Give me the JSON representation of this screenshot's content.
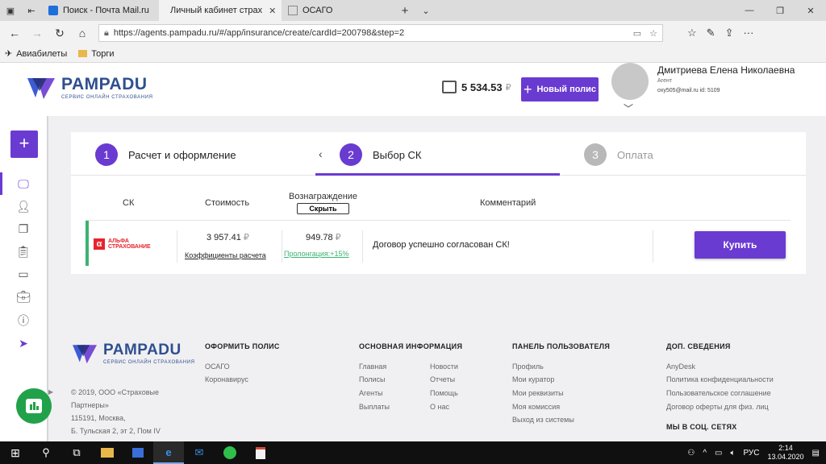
{
  "browser": {
    "tabs": [
      {
        "label": "Поиск - Почта Mail.ru",
        "active": false
      },
      {
        "label": "Личный кабинет страх",
        "active": true
      },
      {
        "label": "ОСАГО",
        "active": false
      }
    ],
    "url": "https://agents.pampadu.ru/#/app/insurance/create/cardId=200798&step=2",
    "favorites": [
      "Авиабилеты",
      "Торги"
    ]
  },
  "header": {
    "logo_name": "PAMPADU",
    "logo_sub": "СЕРВИС ОНЛАЙН СТРАХОВАНИЯ",
    "balance": "5 534.53",
    "currency": "₽",
    "new_policy_label": "Новый полис",
    "user_name": "Дмитриева Елена Николаевна",
    "user_role": "Агент",
    "user_meta": "oxy505@mail.ru   id: 5109"
  },
  "wizard": {
    "steps": [
      {
        "num": "1",
        "label": "Расчет и оформление"
      },
      {
        "num": "2",
        "label": "Выбор СК"
      },
      {
        "num": "3",
        "label": "Оплата"
      }
    ],
    "columns": {
      "sk": "СК",
      "cost": "Стоимость",
      "reward": "Вознаграждение",
      "comment": "Комментарий"
    },
    "hide_label": "Скрыть",
    "offer": {
      "company_line1": "АЛЬФА",
      "company_line2": "СТРАХОВАНИЕ",
      "price": "3 957.41",
      "currency": "₽",
      "coef_link": "Коэффициенты расчета",
      "reward": "949.78",
      "prolong": "Пролонгация:+15%",
      "comment": "Договор успешно согласован СК!",
      "buy_label": "Купить"
    }
  },
  "footer": {
    "copyright": "© 2019, ООО «Страховые Партнеры»",
    "address1": "115191, Москва,",
    "address2": "Б. Тульская 2, эт 2, Пом IV",
    "col1": {
      "title": "ОФОРМИТЬ ПОЛИС",
      "links": [
        "ОСАГО",
        "Коронавирус"
      ]
    },
    "col2": {
      "title": "ОСНОВНАЯ ИНФОРМАЦИЯ",
      "links_a": [
        "Главная",
        "Полисы",
        "Агенты",
        "Выплаты"
      ],
      "links_b": [
        "Новости",
        "Отчеты",
        "Помощь",
        "О нас"
      ]
    },
    "col3": {
      "title": "ПАНЕЛЬ ПОЛЬЗОВАТЕЛЯ",
      "links": [
        "Профиль",
        "Мои куратор",
        "Мои реквизиты",
        "Моя комиссия",
        "Выход из системы"
      ]
    },
    "col4": {
      "title": "ДОП. СВЕДЕНИЯ",
      "links": [
        "AnyDesk",
        "Политика конфиденциальности",
        "Пользовательское соглашение",
        "Договор оферты для физ. лиц"
      ],
      "social_title": "МЫ В СОЦ. СЕТЯХ"
    }
  },
  "taskbar": {
    "lang": "РУС",
    "time": "2:14",
    "date": "13.04.2020"
  },
  "colors": {
    "accent": "#6a3bd1",
    "success": "#3cb371",
    "alfa": "#e8232e"
  }
}
